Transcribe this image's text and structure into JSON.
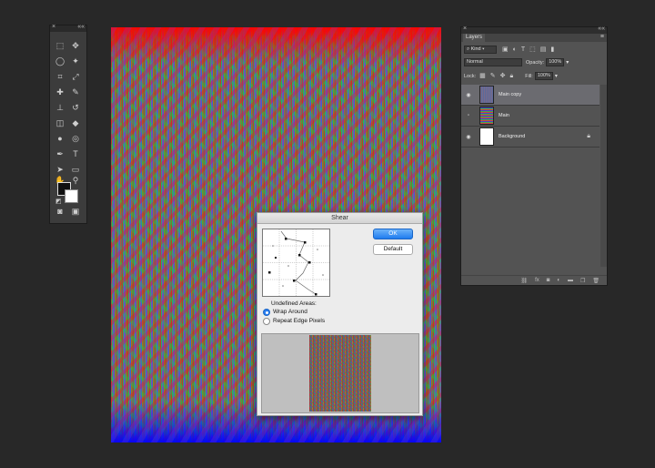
{
  "colors": {
    "workspace": "#282828",
    "panel": "#535353",
    "selected_layer": "#6b6b70",
    "dialog": "#ececec",
    "accent_button": "#1f7cef"
  },
  "tools_panel": {
    "collapse_glyph": "««",
    "close_glyph": "×",
    "icons": [
      "marquee-icon",
      "move-icon",
      "lasso-icon",
      "magic-wand-icon",
      "crop-icon",
      "eyedropper-icon",
      "healing-brush-icon",
      "brush-icon",
      "clone-stamp-icon",
      "history-brush-icon",
      "eraser-icon",
      "paint-bucket-icon",
      "blur-icon",
      "dodge-icon",
      "pen-icon",
      "type-icon",
      "path-selection-icon",
      "rectangle-icon",
      "hand-icon",
      "zoom-icon",
      "quick-mask-icon",
      "screen-mode-icon"
    ]
  },
  "layers_panel": {
    "tab_label": "Layers",
    "collapse_glyph": "««",
    "close_glyph": "×",
    "menu_glyph": "≡",
    "filter_kind": "Kind",
    "blend_mode": "Normal",
    "opacity_label": "Opacity:",
    "opacity_value": "100%",
    "lock_label": "Lock:",
    "fill_label": "Fill:",
    "fill_value": "100%",
    "layers": [
      {
        "name": "Main copy",
        "visible": true,
        "selected": true
      },
      {
        "name": "Main",
        "visible": false,
        "selected": false
      },
      {
        "name": "Background",
        "visible": true,
        "selected": false,
        "locked": true
      }
    ],
    "footer_icons": [
      "link-icon",
      "fx-icon",
      "mask-icon",
      "adjustment-icon",
      "folder-icon",
      "new-layer-icon",
      "trash-icon"
    ]
  },
  "shear_dialog": {
    "title": "Shear",
    "ok_label": "OK",
    "default_label": "Default",
    "undefined_areas_label": "Undefined Areas:",
    "wrap_around_label": "Wrap Around",
    "repeat_edge_label": "Repeat Edge Pixels",
    "selected_option": "wrap_around"
  }
}
